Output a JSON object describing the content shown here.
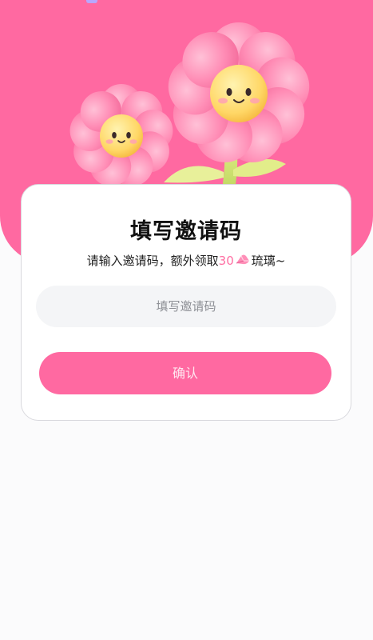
{
  "status_bar": {
    "indicator_color": "#b8a7ff"
  },
  "hero": {
    "background_color": "#ff69a1",
    "illustration": "two-smiling-pink-flowers"
  },
  "dialog": {
    "title": "填写邀请码",
    "subtitle_prefix": "请输入邀请码，额外领取",
    "reward_amount": "30",
    "reward_icon": "glass-gem-icon",
    "subtitle_suffix": "琉璃~",
    "input": {
      "value": "",
      "placeholder": "填写邀请码"
    },
    "confirm_label": "确认"
  },
  "colors": {
    "accent": "#ff69a1",
    "reward_text": "#ff6fa3"
  }
}
